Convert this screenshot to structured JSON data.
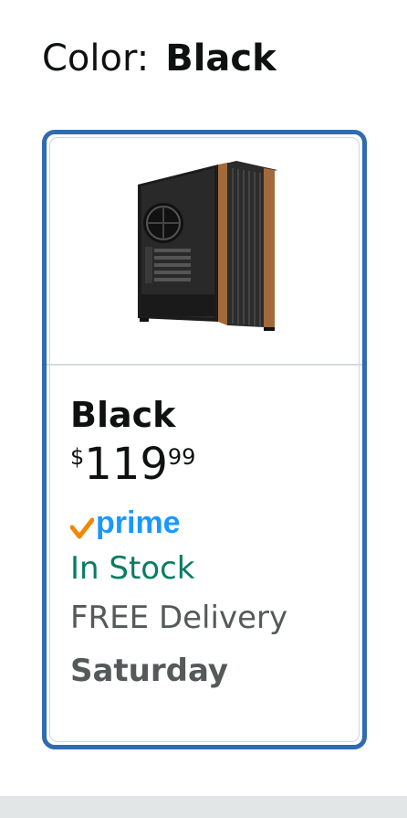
{
  "color_selector": {
    "label": "Color:",
    "selected_value": "Black"
  },
  "swatch": {
    "image_alt_icon": "pc-case-image",
    "name": "Black",
    "price": {
      "symbol": "$",
      "whole": "119",
      "fraction": "99"
    },
    "prime": {
      "check_color": "#f08804",
      "word": "prime",
      "word_color": "#1a98ff"
    },
    "stock_status": "In Stock",
    "delivery_label": "FREE Delivery",
    "delivery_day": "Saturday"
  },
  "colors": {
    "selected_border": "#2f6bb0",
    "in_stock": "#067d62",
    "secondary_text": "#565959"
  }
}
